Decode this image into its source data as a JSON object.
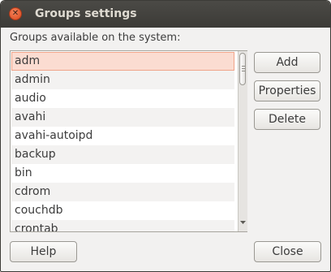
{
  "window": {
    "title": "Groups settings"
  },
  "section_label": "Groups available on the system:",
  "groups": [
    "adm",
    "admin",
    "audio",
    "avahi",
    "avahi-autoipd",
    "backup",
    "bin",
    "cdrom",
    "couchdb",
    "crontab"
  ],
  "selected_index": 0,
  "buttons": {
    "add": "Add",
    "properties": "Properties",
    "delete": "Delete",
    "help": "Help",
    "close": "Close"
  },
  "colors": {
    "selection_bg": "#fbdcd1",
    "selection_border": "#f0a48a",
    "titlebar": "#3c3b37",
    "close_button": "#e8582a"
  }
}
